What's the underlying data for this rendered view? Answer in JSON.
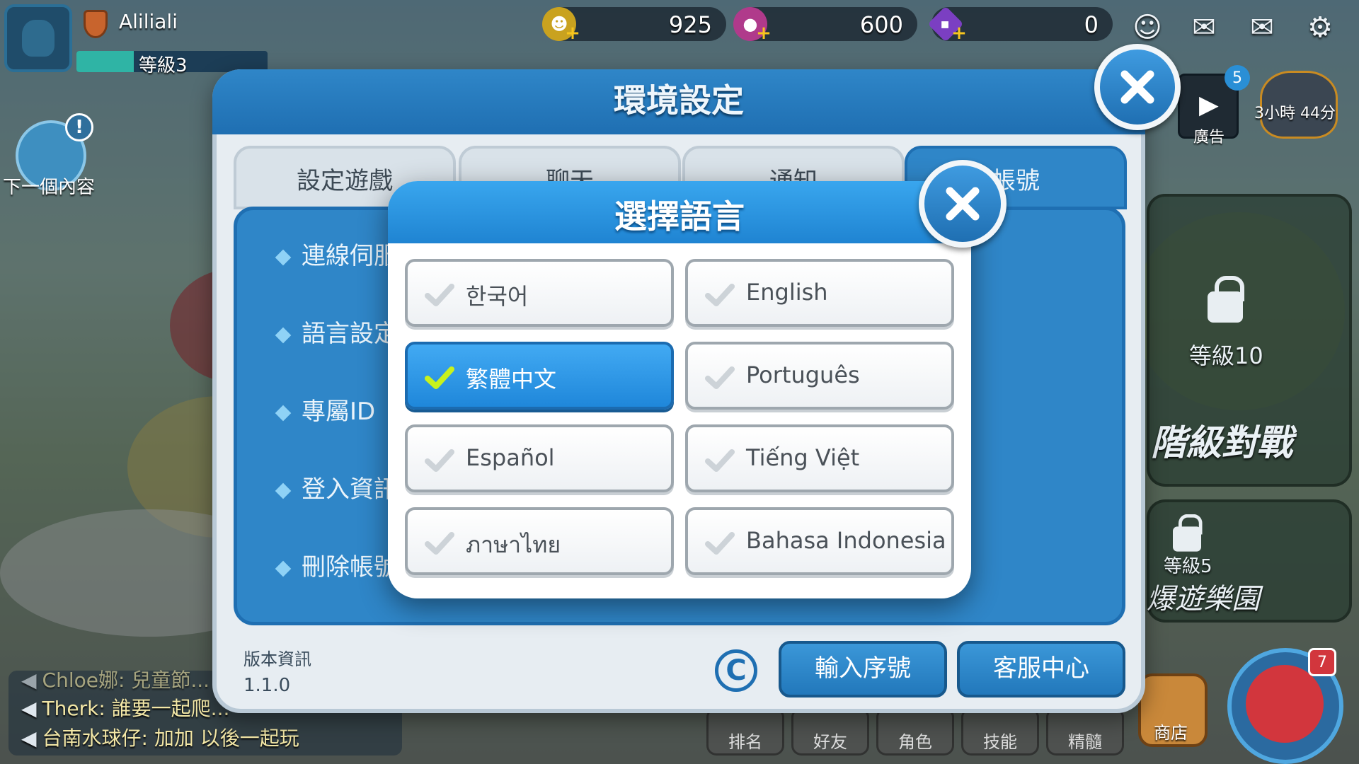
{
  "hud": {
    "player_name": "Aliliali",
    "level": "等級3",
    "xp_fraction": 0.3,
    "gold": "925",
    "gems": "600",
    "diamonds": "0",
    "icons": [
      "add-friend-icon",
      "chat-bubble-icon",
      "mail-icon",
      "gear-icon"
    ]
  },
  "left": {
    "next_content": "下一個內容"
  },
  "right": {
    "ad_count": "5",
    "ad_label": "廣告",
    "timer_label": "3小時 44分",
    "ranked": {
      "level": "等級10",
      "title": "階級對戰"
    },
    "fun": {
      "level": "等級5",
      "title": "爆遊樂園"
    },
    "bottom_nav": [
      "排名",
      "好友",
      "角色",
      "技能",
      "精髓"
    ],
    "shop_label": "商店",
    "char_badge": "7"
  },
  "chat": [
    {
      "user": "Chloe",
      "text": "Chloe娜: 兒童節..."
    },
    {
      "user": "Therk",
      "text": "Therk: 誰要一起爬..."
    },
    {
      "user": "台南水球仔",
      "text": "台南水球仔: 加加  以後一起玩"
    }
  ],
  "settings": {
    "title": "環境設定",
    "tabs": [
      "設定遊戲",
      "聊天",
      "通知",
      "帳號"
    ],
    "active_tab": 3,
    "menu": [
      "連線伺服器",
      "語言設定",
      "專屬ID",
      "登入資訊",
      "刪除帳號"
    ],
    "version_label": "版本資訊",
    "version": "1.1.0",
    "copyright_symbol": "C",
    "buttons": {
      "coupon": "輸入序號",
      "support": "客服中心"
    }
  },
  "language": {
    "title": "選擇語言",
    "selected": "繁體中文",
    "options": [
      "한국어",
      "English",
      "繁體中文",
      "Português",
      "Español",
      "Tiếng Việt",
      "ภาษาไทย",
      "Bahasa Indonesia"
    ]
  },
  "colors": {
    "accent": "#1f84d2",
    "check_selected": "#c8f21e",
    "check_unselected": "#cdd3d8"
  }
}
